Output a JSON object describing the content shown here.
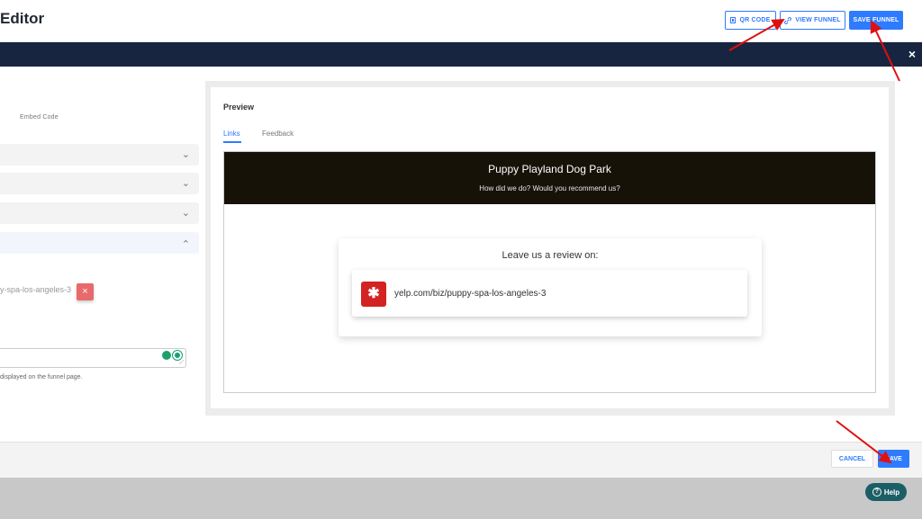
{
  "header": {
    "title": "Editor",
    "qr_label": "QR CODE",
    "view_label": "VIEW FUNNEL",
    "save_funnel_label": "SAVE FUNNEL"
  },
  "modal": {
    "close_glyph": "×",
    "left": {
      "embed_tab": "Embed Code",
      "link_value": "y-spa-los-angeles-3",
      "remove_glyph": "×",
      "help_text": "displayed on the funnel page."
    },
    "preview": {
      "title": "Preview",
      "tabs": [
        "Links",
        "Feedback"
      ],
      "hero_title": "Puppy Playland Dog Park",
      "hero_subtitle": "How did we do? Would you recommend us?",
      "leave_review": "Leave us a review on:",
      "yelp_url": "yelp.com/biz/puppy-spa-los-angeles-3"
    },
    "footer": {
      "cancel_label": "CANCEL",
      "save_label": "SAVE"
    }
  },
  "help_widget": {
    "label": "Help",
    "glyph": "?"
  },
  "colors": {
    "accent": "#2e7bff",
    "nav": "#182540",
    "hero": "#161208",
    "yelp": "#d32323",
    "annotation": "#e01010"
  },
  "icons": {
    "qr": "qr-code-icon",
    "view": "link-icon",
    "close": "close-icon",
    "chevron": "chevron-icon",
    "yelp": "yelp-logo-icon",
    "grammarly": "grammarly-icon",
    "help": "question-icon"
  }
}
